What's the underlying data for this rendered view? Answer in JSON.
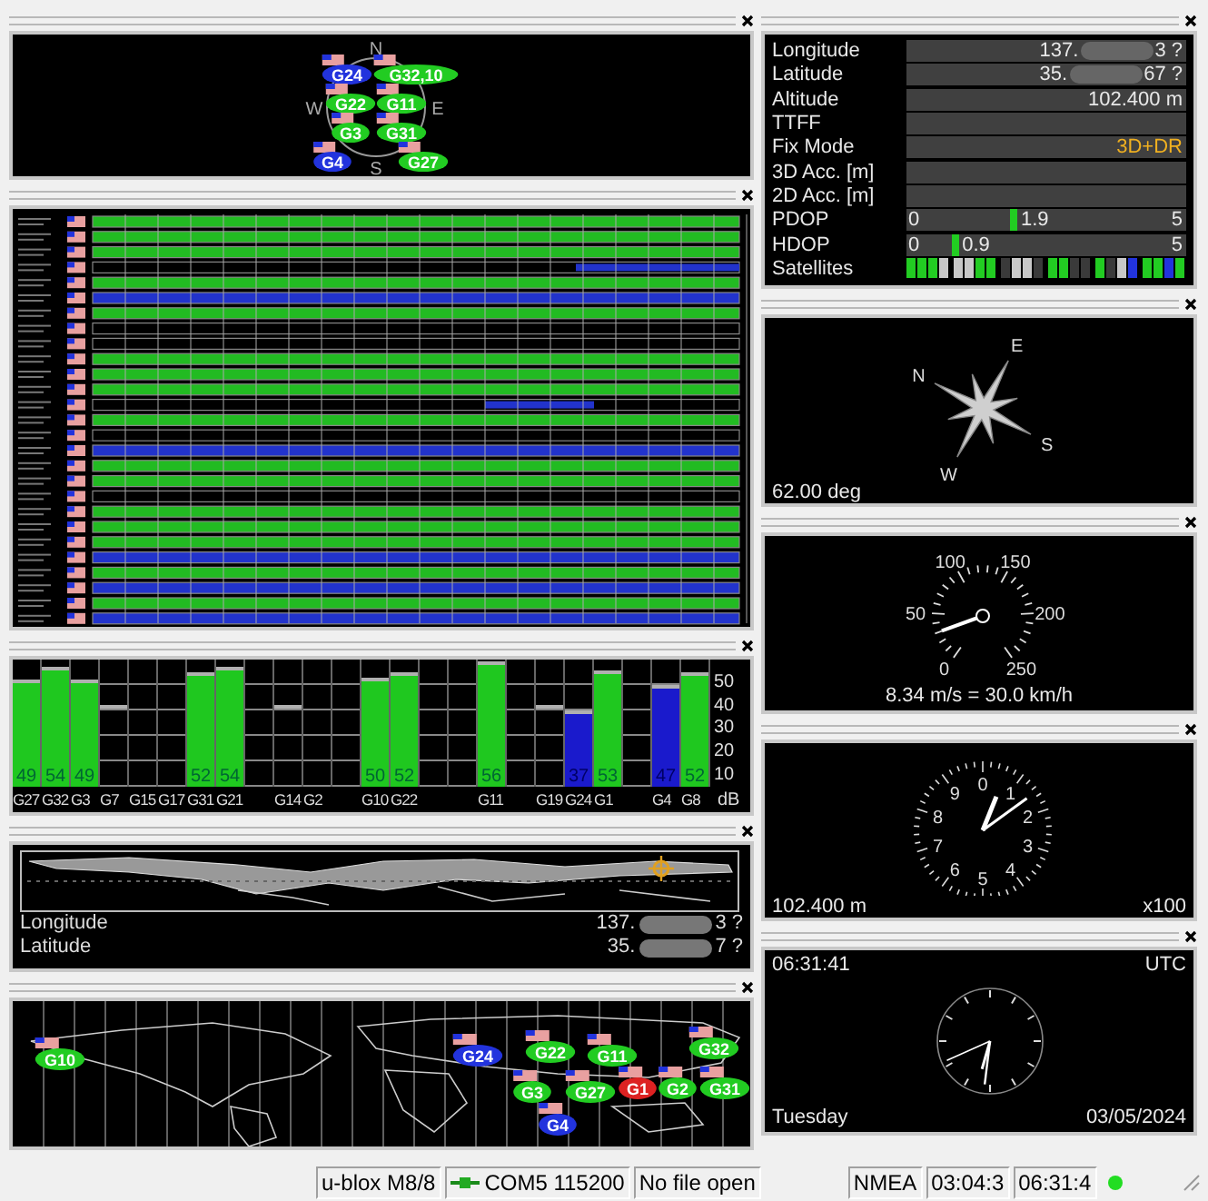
{
  "sky_view": {
    "directions": [
      "N",
      "E",
      "S",
      "W"
    ],
    "satellites": [
      {
        "label": "G24",
        "color": "#2233dd"
      },
      {
        "label": "G22",
        "color": "#22cc22"
      },
      {
        "label": "G32,10",
        "color": "#22cc22"
      },
      {
        "label": "G11",
        "color": "#22cc22"
      },
      {
        "label": "G3",
        "color": "#22cc22"
      },
      {
        "label": "G31",
        "color": "#22cc22"
      },
      {
        "label": "G4",
        "color": "#2233dd"
      },
      {
        "label": "G27",
        "color": "#22cc22"
      }
    ]
  },
  "signal_chart": {
    "unit": "dB",
    "scale": [
      "50",
      "40",
      "30",
      "20",
      "10"
    ],
    "satellites": [
      {
        "label": "G27",
        "value": "49",
        "level": 0.84,
        "kind": "used"
      },
      {
        "label": "G32",
        "value": "54",
        "level": 0.94,
        "kind": "used"
      },
      {
        "label": "G3",
        "value": "49",
        "level": 0.84,
        "kind": "used"
      },
      {
        "label": "G7",
        "level": 0.64,
        "kind": "idle"
      },
      {
        "label": "G15",
        "kind": "none"
      },
      {
        "label": "G17",
        "kind": "none"
      },
      {
        "label": "G31",
        "value": "52",
        "level": 0.9,
        "kind": "used"
      },
      {
        "label": "G21",
        "value": "54",
        "level": 0.94,
        "kind": "used"
      },
      {
        "kind": "none"
      },
      {
        "label": "G14",
        "level": 0.64,
        "kind": "idle"
      },
      {
        "label": "G2",
        "kind": "none"
      },
      {
        "kind": "none"
      },
      {
        "label": "G10",
        "value": "50",
        "level": 0.86,
        "kind": "used"
      },
      {
        "label": "G22",
        "value": "52",
        "level": 0.9,
        "kind": "used"
      },
      {
        "kind": "none"
      },
      {
        "kind": "none"
      },
      {
        "label": "G11",
        "value": "56",
        "level": 0.98,
        "kind": "used"
      },
      {
        "kind": "none"
      },
      {
        "label": "G19",
        "level": 0.64,
        "kind": "idle"
      },
      {
        "label": "G24",
        "value": "37",
        "level": 0.6,
        "kind": "tracked"
      },
      {
        "label": "G1",
        "value": "53",
        "level": 0.92,
        "kind": "used"
      },
      {
        "kind": "none"
      },
      {
        "label": "G4",
        "value": "47",
        "level": 0.8,
        "kind": "tracked"
      },
      {
        "label": "G8",
        "value": "52",
        "level": 0.9,
        "kind": "used"
      }
    ]
  },
  "position_map": {
    "rows": [
      {
        "label": "Longitude",
        "value": "137.",
        "value_end": "3 ?",
        "redacted": true
      },
      {
        "label": "Latitude",
        "value": "35.",
        "value_end": "7 ?",
        "redacted": true
      }
    ]
  },
  "world_map": {
    "satellites": [
      {
        "label": "G10",
        "color": "#22cc22"
      },
      {
        "label": "G24",
        "color": "#2233dd"
      },
      {
        "label": "G22",
        "color": "#22cc22"
      },
      {
        "label": "G11",
        "color": "#22cc22"
      },
      {
        "label": "G32",
        "color": "#22cc22"
      },
      {
        "label": "G3",
        "color": "#22cc22"
      },
      {
        "label": "G27",
        "color": "#22cc22"
      },
      {
        "label": "G1",
        "color": "#dd2222"
      },
      {
        "label": "G2",
        "color": "#22cc22"
      },
      {
        "label": "G31",
        "color": "#22cc22"
      },
      {
        "label": "G4",
        "color": "#2233dd"
      }
    ]
  },
  "data_view": {
    "rows": [
      {
        "kind": "text",
        "label": "Longitude",
        "value": "137.",
        "value_end": "3 ?",
        "redacted": true
      },
      {
        "kind": "text",
        "label": "Latitude",
        "value": "35.",
        "value_end": "67 ?",
        "redacted": true
      },
      {
        "kind": "text",
        "label": "Altitude",
        "value": "102.400 m"
      },
      {
        "kind": "text",
        "label": "TTFF"
      },
      {
        "kind": "status",
        "label": "Fix Mode",
        "value": "3D+DR"
      },
      {
        "kind": "text",
        "label": "3D Acc. [m]"
      },
      {
        "kind": "text",
        "label": "2D Acc. [m]"
      },
      {
        "kind": "dop",
        "label": "PDOP",
        "min": "0",
        "value": "1.9",
        "max": "5",
        "level": 0.37
      },
      {
        "kind": "dop",
        "label": "HDOP",
        "min": "0",
        "value": "0.9",
        "max": "5",
        "level": 0.16
      },
      {
        "kind": "sats",
        "label": "Satellites",
        "cells": [
          {
            "color": "#22cc22"
          },
          {
            "color": "#22cc22"
          },
          {
            "color": "#22cc22"
          },
          {
            "color": "#c8c8c8"
          },
          {
            "color": "#c8c8c8"
          },
          {
            "color": "#c8c8c8"
          },
          {
            "color": "#22cc22"
          },
          {
            "color": "#22cc22"
          },
          {
            "color": "#3a3a3a"
          },
          {
            "color": "#c8c8c8"
          },
          {
            "color": "#c8c8c8"
          },
          {
            "color": "#3a3a3a"
          },
          {
            "color": "#22cc22"
          },
          {
            "color": "#22cc22"
          },
          {
            "color": "#3a3a3a"
          },
          {
            "color": "#3a3a3a"
          },
          {
            "color": "#22cc22"
          },
          {
            "color": "#3a3a3a"
          },
          {
            "color": "#c8c8c8"
          },
          {
            "color": "#2233dd"
          },
          {
            "color": "#22cc22"
          },
          {
            "color": "#22cc22"
          },
          {
            "color": "#2233dd"
          },
          {
            "color": "#22cc22"
          }
        ]
      }
    ]
  },
  "compass": {
    "directions": [
      "N",
      "E",
      "S",
      "W"
    ],
    "heading": "62.00 deg"
  },
  "speedometer": {
    "marks": [
      "0",
      "50",
      "100",
      "150",
      "200",
      "250"
    ],
    "reading": "8.34 m/s = 30.0 km/h"
  },
  "altimeter": {
    "marks": [
      "0",
      "1",
      "2",
      "3",
      "4",
      "5",
      "6",
      "7",
      "8",
      "9"
    ],
    "reading": "102.400 m",
    "scale": "x100"
  },
  "clock": {
    "time": "06:31:41",
    "zone": "UTC",
    "day": "Tuesday",
    "date": "03/05/2024"
  },
  "status_bar": {
    "items": [
      {
        "kind": "text",
        "text": "u-blox M8/8"
      },
      {
        "kind": "port",
        "text": "COM5 115200"
      },
      {
        "kind": "text",
        "text": "No file open"
      },
      {
        "kind": "gap"
      },
      {
        "kind": "text",
        "text": "NMEA"
      },
      {
        "kind": "text",
        "text": "03:04:3"
      },
      {
        "kind": "text",
        "text": "06:31:4"
      }
    ],
    "connected": true
  }
}
